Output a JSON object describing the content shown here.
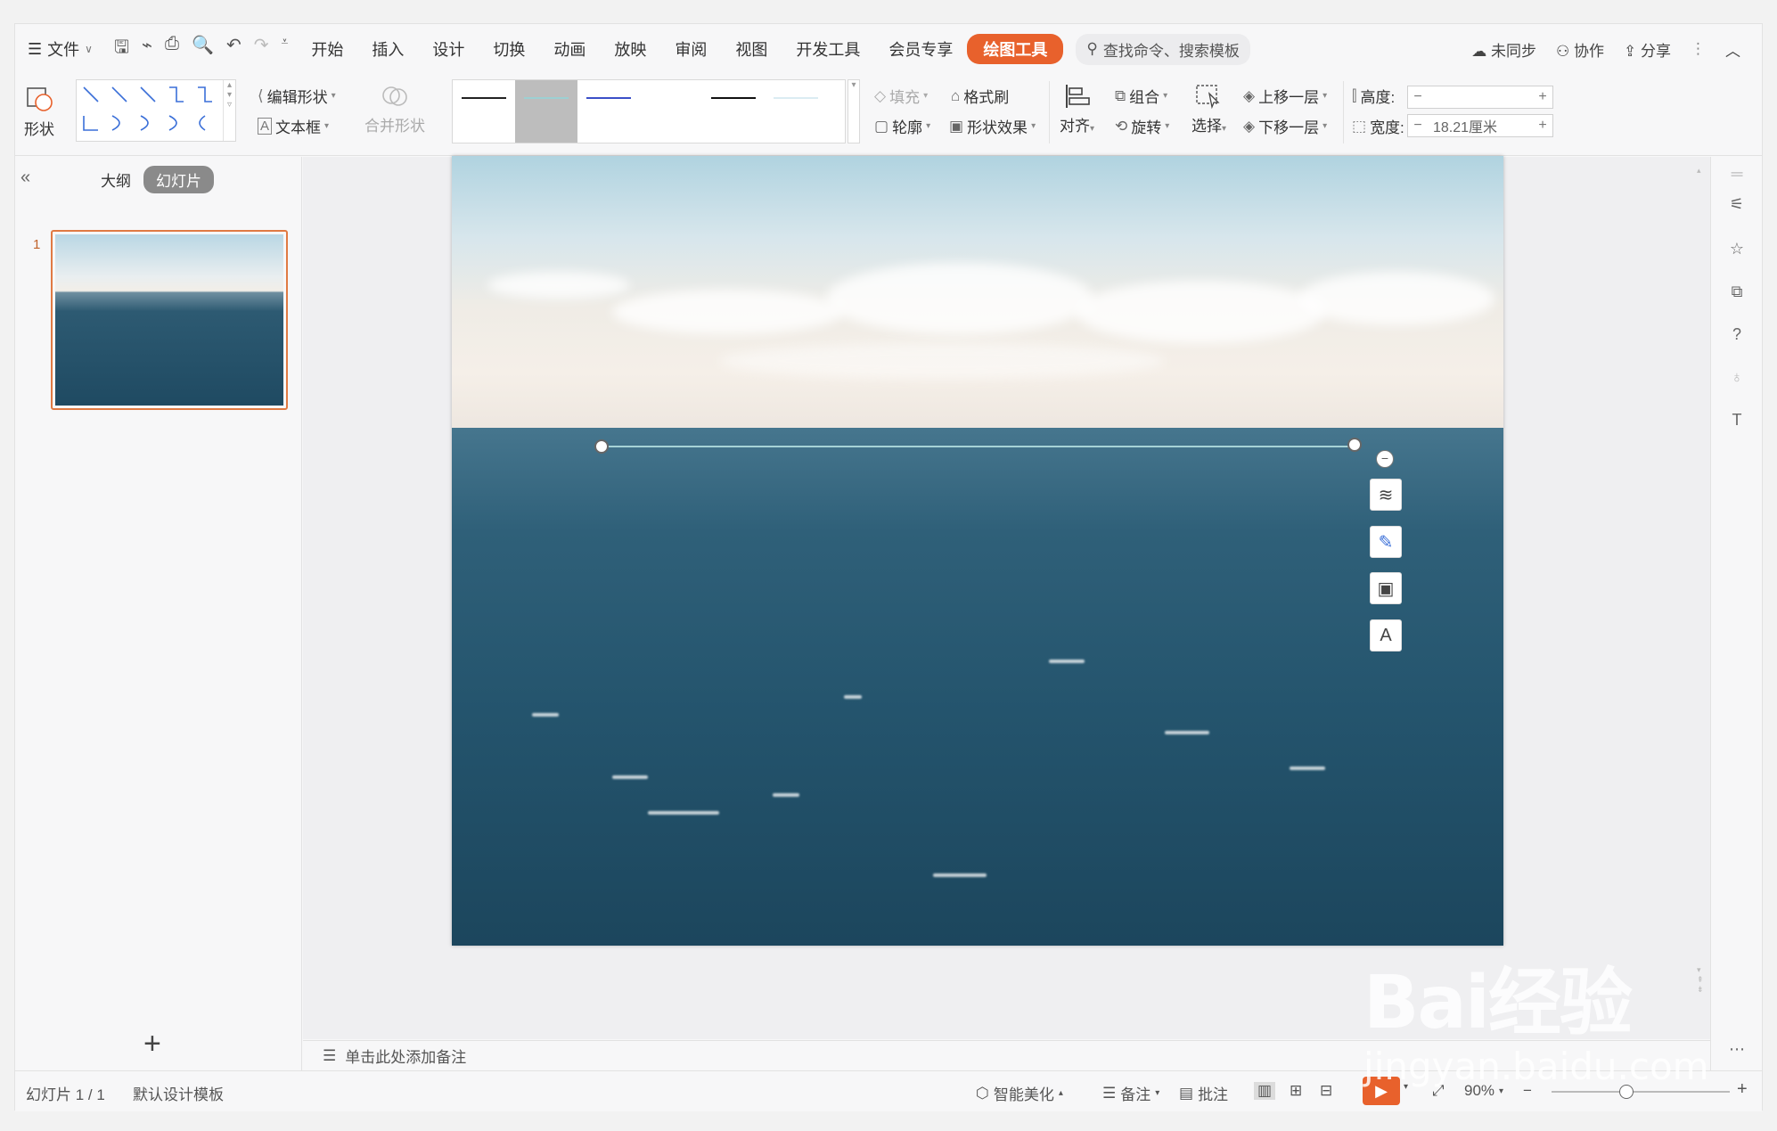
{
  "menu": {
    "file_label": "文件",
    "tabs": [
      "开始",
      "插入",
      "设计",
      "切换",
      "动画",
      "放映",
      "审阅",
      "视图",
      "开发工具",
      "会员专享",
      "绘图工具"
    ],
    "active_tab": "绘图工具",
    "search_placeholder": "查找命令、搜索模板",
    "sync_label": "未同步",
    "collab_label": "协作",
    "share_label": "分享"
  },
  "ribbon": {
    "shape_label": "形状",
    "edit_shape_label": "编辑形状",
    "textbox_label": "文本框",
    "merge_shape_label": "合并形状",
    "fill_label": "填充",
    "format_painter_label": "格式刷",
    "outline_label": "轮廓",
    "shape_effect_label": "形状效果",
    "align_label": "对齐",
    "group_label": "组合",
    "rotate_label": "旋转",
    "select_label": "选择",
    "bring_forward_label": "上移一层",
    "send_backward_label": "下移一层",
    "height_label": "高度:",
    "height_value": "",
    "width_label": "宽度:",
    "width_value": "18.21厘米"
  },
  "left_panel": {
    "outline_tab": "大纲",
    "slides_tab": "幻灯片",
    "slide_number": "1",
    "add_slide": "+"
  },
  "notes": {
    "placeholder": "单击此处添加备注"
  },
  "status": {
    "slide_indicator": "幻灯片 1 / 1",
    "template": "默认设计模板",
    "smart_beautify": "智能美化",
    "notes_label": "备注",
    "comments_label": "批注",
    "zoom": "90%"
  },
  "watermark": {
    "line1": "Bai经验",
    "line2": "jingyan.baidu.com"
  },
  "colors": {
    "accent": "#e8612c",
    "thumb_border": "#e07a43",
    "line_shape": "#a6d2d6"
  }
}
